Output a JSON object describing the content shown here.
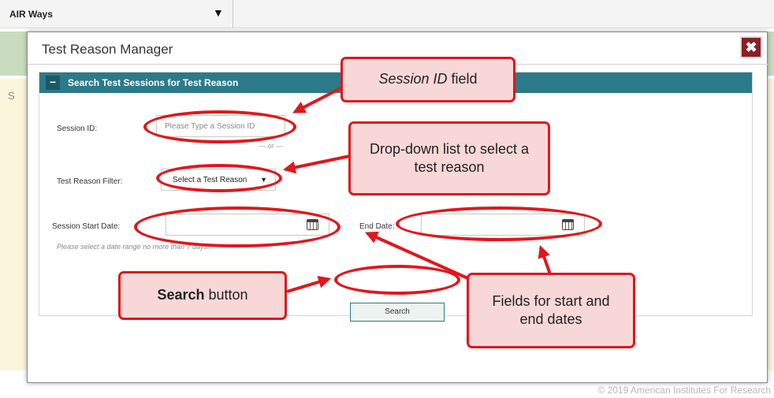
{
  "app": {
    "selector_label": "AIR Ways",
    "footer": "© 2019 American Institutes For Research"
  },
  "modal": {
    "title": "Test Reason Manager",
    "close_glyph": "✖",
    "panel_toggle": "−",
    "panel_title": "Search Test Sessions for Test Reason",
    "session_id_label": "Session ID:",
    "session_id_placeholder": "Please Type a Session ID",
    "session_id_value": "",
    "or_text": "— or —",
    "filter_label": "Test Reason Filter:",
    "filter_selected": "Select a Test Reason",
    "start_date_label": "Session Start Date:",
    "start_date_value": "",
    "end_date_label": "End Date:",
    "end_date_value": "",
    "date_hint": "Please select a date range no more than 7 days.",
    "search_label": "Search"
  },
  "annotations": {
    "session_id_field": {
      "italic": "Session ID",
      "rest": " field"
    },
    "dropdown": "Drop-down list to select a test reason",
    "search_button": {
      "bold": "Search",
      "rest": " button"
    },
    "dates": "Fields for start and end dates"
  },
  "colors": {
    "header_teal": "#2b7a8a",
    "close_red": "#8f1c23",
    "annotation_red": "#e0171c",
    "callout_fill": "#f7d7d7"
  }
}
